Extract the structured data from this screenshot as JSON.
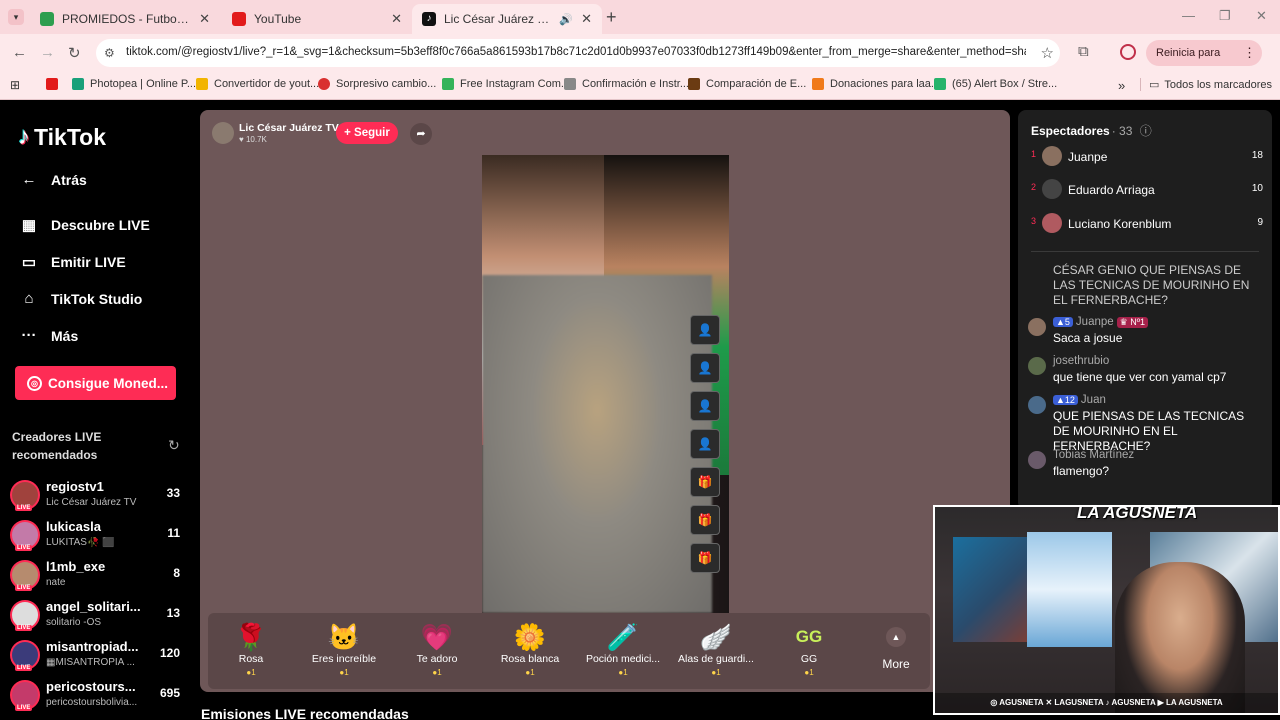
{
  "browser": {
    "tabs": [
      {
        "title": "PROMIEDOS - Futbol Argentino",
        "color": "#2e9e4f"
      },
      {
        "title": "YouTube",
        "color": "#e21b1b"
      },
      {
        "title": "Lic César Juárez TV (@regiostv1)",
        "color": "#111111"
      }
    ],
    "url": "tiktok.com/@regiostv1/live?_r=1&_svg=1&checksum=5b3eff8f0c766a5a861593b17b8c71c2d01d0b9937e07033f0db1273ff149b09&enter_from_merge=share&enter_method=share...",
    "refresh_label": "Reinicia para actualizar",
    "bookmarks": [
      {
        "label": "",
        "color": "#e21b1b"
      },
      {
        "label": "Photopea | Online P...",
        "color": "#19a07a"
      },
      {
        "label": "Convertidor de yout...",
        "color": "#f2b400"
      },
      {
        "label": "Sorpresivo cambio...",
        "color": "#d93030"
      },
      {
        "label": "Free Instagram Com...",
        "color": "#34b35a"
      },
      {
        "label": "Confirmación e Instr...",
        "color": "#888888"
      },
      {
        "label": "Comparación de E...",
        "color": "#6b3b12"
      },
      {
        "label": "Donaciones para laa...",
        "color": "#f07a1a"
      },
      {
        "label": "(65) Alert Box / Stre...",
        "color": "#27b36b"
      }
    ],
    "bookmarks_overflow": "»",
    "all_bookmarks": "Todos los marcadores"
  },
  "sidebar": {
    "logo": "TikTok",
    "nav": [
      {
        "label": "Atrás",
        "icon": "←"
      },
      {
        "label": "Descubre LIVE",
        "icon": "▦"
      },
      {
        "label": "Emitir LIVE",
        "icon": "▭"
      },
      {
        "label": "TikTok Studio",
        "icon": "⌂"
      },
      {
        "label": "Más",
        "icon": "···"
      }
    ],
    "coins_button": "Consigue Moned...",
    "recommended_title": "Creadores LIVE recomendados",
    "live_tag": "LIVE",
    "creators": [
      {
        "name": "regiostv1",
        "sub": "Lic César Juárez TV",
        "count": "33"
      },
      {
        "name": "lukicasla",
        "sub": "LUKITAS🥀 ⬛",
        "count": "11"
      },
      {
        "name": "l1mb_exe",
        "sub": "nate",
        "count": "8"
      },
      {
        "name": "angel_solitari...",
        "sub": "solitario -OS",
        "count": "13"
      },
      {
        "name": "misantropiad...",
        "sub": "▦MISANTROPIA ...",
        "count": "120"
      },
      {
        "name": "pericostours...",
        "sub": "pericostoursbolivia...",
        "count": "695"
      }
    ]
  },
  "live": {
    "host_name": "Lic César Juárez TV",
    "host_likes": "♥ 10.7K",
    "follow_label": "+ Seguir",
    "gifts": [
      {
        "name": "Rosa",
        "icon": "🌹",
        "price": "●1"
      },
      {
        "name": "Eres increíble",
        "icon": "🐱",
        "price": "●1"
      },
      {
        "name": "Te adoro",
        "icon": "💗",
        "price": "●1"
      },
      {
        "name": "Rosa blanca",
        "icon": "🌼",
        "price": "●1"
      },
      {
        "name": "Poción medici...",
        "icon": "🧪",
        "price": "●1"
      },
      {
        "name": "Alas de guardi...",
        "icon": "🪽",
        "price": "●1"
      },
      {
        "name": "GG",
        "icon": "GG",
        "price": "●1"
      }
    ],
    "more_label": "More",
    "recommended_bottom": "Emisiones LIVE recomendadas"
  },
  "chat": {
    "spectators_label": "Espectadores",
    "spectators_count": "· 33",
    "top": [
      {
        "rank": "1",
        "name": "Juanpe",
        "score": "18"
      },
      {
        "rank": "2",
        "name": "Eduardo Arriaga",
        "score": "10"
      },
      {
        "rank": "3",
        "name": "Luciano Korenblum",
        "score": "9"
      }
    ],
    "messages": [
      {
        "user": "",
        "level": "",
        "badge": "",
        "text": "CÉSAR GENIO QUE PIENSAS DE LAS TECNICAS DE MOURINHO EN EL FERNERBACHE?"
      },
      {
        "user": "Juanpe",
        "level": "▲5",
        "badge": "♛ Nº1",
        "text": "Saca a josue"
      },
      {
        "user": "josethrubio",
        "level": "",
        "badge": "",
        "text": "que tiene que ver con yamal cp7"
      },
      {
        "user": "Juan",
        "level": "▲12",
        "badge": "",
        "text": "QUE PIENSAS DE LAS TECNICAS DE MOURINHO EN EL FERNERBACHE?"
      },
      {
        "user": "Tobias Martínez",
        "level": "",
        "badge": "",
        "text": "flamengo?"
      }
    ]
  },
  "overlay": {
    "brand": "LA AGUSNETA",
    "socials": "◎ AGUSNETA  ✕ LAGUSNETA  ♪ AGUSNETA  ▶ LA AGUSNETA"
  }
}
